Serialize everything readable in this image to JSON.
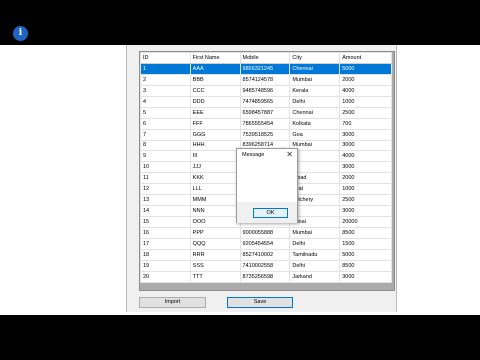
{
  "grid": {
    "columns": [
      "ID",
      "First Name",
      "Mobile",
      "City",
      "Amount"
    ],
    "rows": [
      [
        "1",
        "AAA",
        "9856321245",
        "Chennai",
        "5000"
      ],
      [
        "2",
        "BBB",
        "8574124578",
        "Mumbai",
        "2000"
      ],
      [
        "3",
        "CCC",
        "9485748596",
        "Kerala",
        "4000"
      ],
      [
        "4",
        "DDD",
        "7474859565",
        "Delhi",
        "1000"
      ],
      [
        "5",
        "EEE",
        "6598457887",
        "Chennai",
        "2500"
      ],
      [
        "6",
        "FFF",
        "7865555454",
        "Kolkata",
        "700"
      ],
      [
        "7",
        "GGG",
        "7539518525",
        "Goa",
        "3000"
      ],
      [
        "8",
        "HHH",
        "8396258714",
        "Mumbai",
        "3000"
      ],
      [
        "9",
        "III",
        "",
        "",
        "4000"
      ],
      [
        "10",
        "JJJ",
        "",
        "",
        "3000"
      ],
      [
        "11",
        "KKK",
        "",
        "rabad",
        "2000"
      ],
      [
        "12",
        "LLL",
        "",
        "jarat",
        "1000"
      ],
      [
        "13",
        "MMM",
        "",
        "ndichery",
        "2500"
      ],
      [
        "14",
        "NNN",
        "",
        "lhi",
        "3000"
      ],
      [
        "15",
        "OOO",
        "",
        "ennai",
        "20000"
      ],
      [
        "16",
        "PPP",
        "9000055888",
        "Mumbai",
        "8500"
      ],
      [
        "17",
        "QQQ",
        "9205454554",
        "Delhi",
        "1500"
      ],
      [
        "18",
        "RRR",
        "8527410002",
        "Tamilnadu",
        "5000"
      ],
      [
        "19",
        "SSS",
        "7410002558",
        "Delhi",
        "8500"
      ],
      [
        "20",
        "TTT",
        "8735256598",
        "Jarkand",
        "3000"
      ]
    ],
    "selected_row": 0
  },
  "buttons": {
    "import_label": "Import",
    "save_label": "Save"
  },
  "dialog": {
    "title": "Message",
    "close_glyph": "✕",
    "icon_glyph": "i",
    "message": "Saved",
    "ok_label": "OK"
  },
  "colors": {
    "selection": "#0078d7",
    "info_icon": "#1f65c6"
  },
  "icons": [
    "info-icon",
    "close-icon"
  ]
}
